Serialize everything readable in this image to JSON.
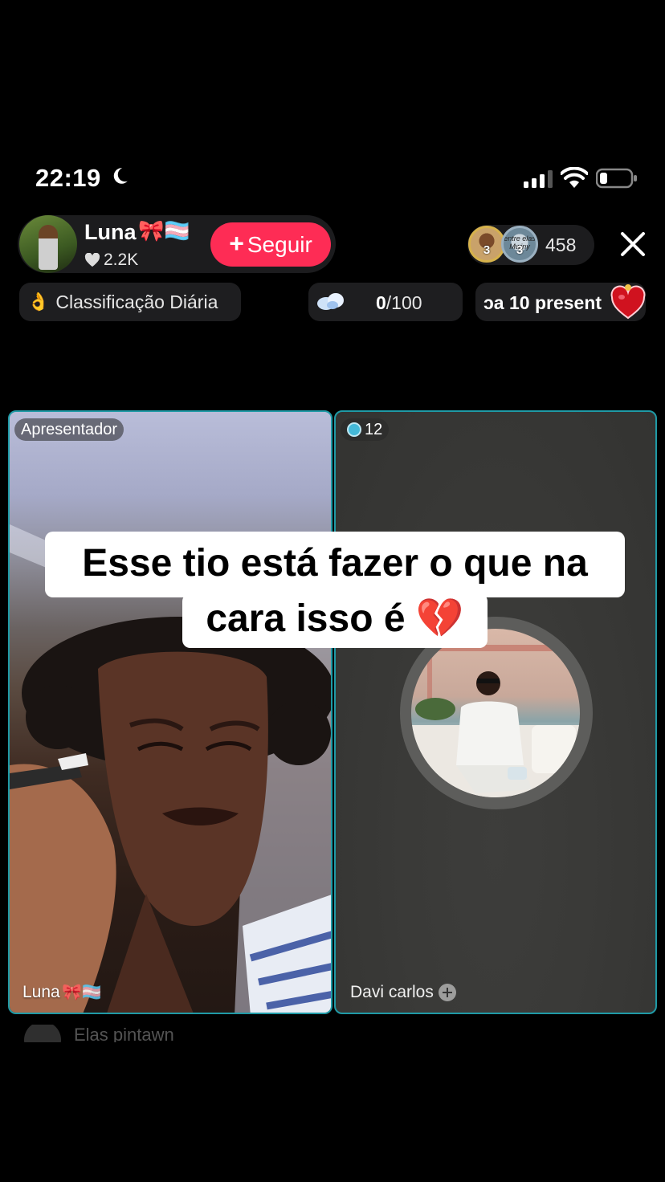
{
  "status": {
    "time": "22:19"
  },
  "host": {
    "name": "Luna",
    "name_emoji": "🎀🏳️‍⚧️",
    "likes": "2.2K",
    "follow_label": "Seguir"
  },
  "viewers": {
    "ranks": [
      "3",
      "3"
    ],
    "second_avatar_text": "entre elas Mwiny",
    "count": "458"
  },
  "pills": {
    "ranking_icon": "👌",
    "ranking_label": "Classificação Diária",
    "goal_done": "0",
    "goal_total": "/100",
    "gift_label": "ɔa 10 present"
  },
  "panels": {
    "host_tag": "Apresentador",
    "left_name": "Luna",
    "left_name_emoji": "🎀🏳️‍⚧️",
    "guest_score": "12",
    "right_name": "Davi carlos"
  },
  "caption": {
    "line1": "Esse tio está fazer o que na",
    "line2": "cara isso é 💔"
  },
  "comment": {
    "text": "Elas pintawn"
  },
  "colors": {
    "follow_button": "#fe2c55",
    "panel_border": "#1f9aa6",
    "background": "#000000"
  },
  "icons": [
    "moon-icon",
    "signal-icon",
    "wifi-icon",
    "battery-icon",
    "heart-icon",
    "close-icon",
    "wings-icon",
    "gift-heart-icon",
    "add-icon"
  ]
}
